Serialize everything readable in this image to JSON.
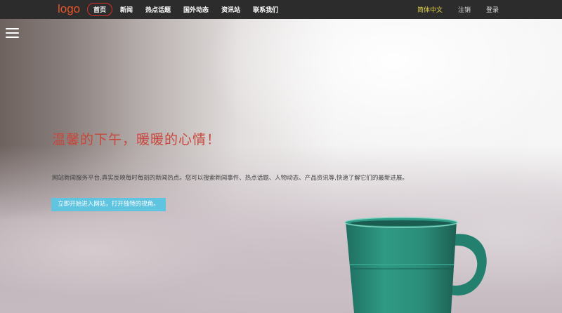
{
  "header": {
    "logo": "logo",
    "nav": [
      "首页",
      "新闻",
      "热点话题",
      "国外动态",
      "资讯站",
      "联系我们"
    ],
    "language": "简体中文",
    "logout": "注销",
    "login": "登录"
  },
  "hero": {
    "headline": "温馨的下午，暖暖的心情！",
    "description": "网站新闻服务平台,真实反映每时每刻的新闻热点。您可以搜索新闻事件、热点话题、人物动态、产品资讯等,快速了解它们的最新进展。",
    "cta": "立即开始进入网站，打开独特的视角。"
  },
  "colors": {
    "topbar": "#2c2c2c",
    "logo": "#e8552a",
    "active_nav_border": "#d9302a",
    "language": "#e6d84a",
    "headline": "#c9463c",
    "cta_background": "#5fc4df",
    "mug": "#2b8f7c"
  },
  "icons": {
    "menu": "hamburger-menu-icon"
  }
}
